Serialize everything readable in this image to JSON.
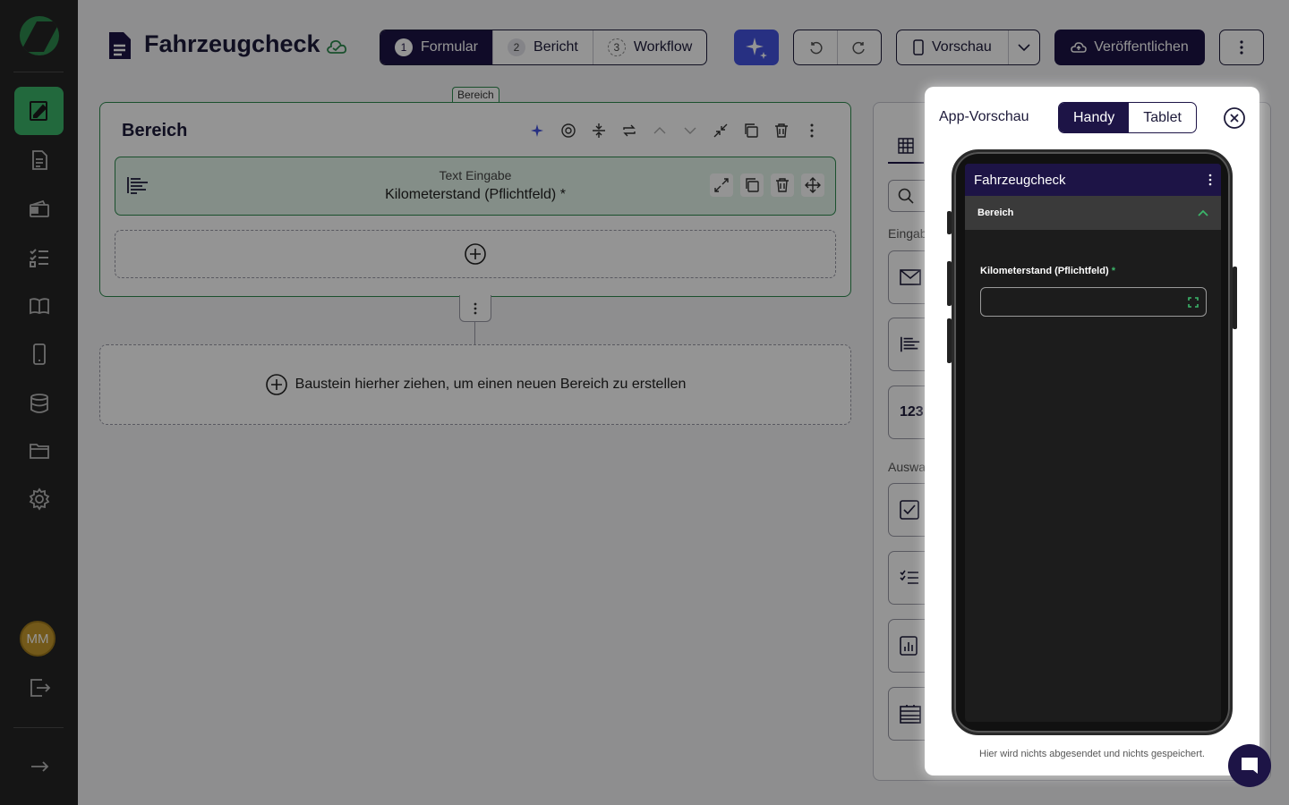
{
  "header": {
    "title": "Fahrzeugcheck",
    "steps": [
      {
        "num": "1",
        "label": "Formular"
      },
      {
        "num": "2",
        "label": "Bericht"
      },
      {
        "num": "3",
        "label": "Workflow"
      }
    ],
    "preview_label": "Vorschau",
    "publish_label": "Veröffentlichen"
  },
  "sidebar": {
    "items": [
      "form-editor-icon",
      "document-icon",
      "wallet-icon",
      "checklist-icon",
      "book-icon",
      "mobile-icon",
      "database-icon",
      "folder-icon",
      "settings-icon"
    ],
    "avatar_initials": "MM"
  },
  "canvas": {
    "section_tag": "Bereich",
    "section_title": "Bereich",
    "field": {
      "type": "Text Eingabe",
      "label": "Kilometerstand (Pflichtfeld) *"
    },
    "drop_hint": "Baustein hierher ziehen, um einen neuen Bereich zu erstellen"
  },
  "builder_panel": {
    "categories": [
      "Eingab",
      "Auswa"
    ],
    "number_block": "123"
  },
  "preview": {
    "title": "App-Vorschau",
    "device_options": [
      "Handy",
      "Tablet"
    ],
    "selected_device": "Handy",
    "note": "Hier wird nichts abgesendet und nichts gespeichert.",
    "app_title": "Fahrzeugcheck",
    "section": "Bereich",
    "field_label": "Kilometerstand (Pflichtfeld)",
    "required_marker": "*"
  },
  "colors": {
    "primary": "#1d1446",
    "accent_green": "#3bb56a",
    "ai_blue": "#4454e0",
    "sidebar_bg": "#252525"
  }
}
